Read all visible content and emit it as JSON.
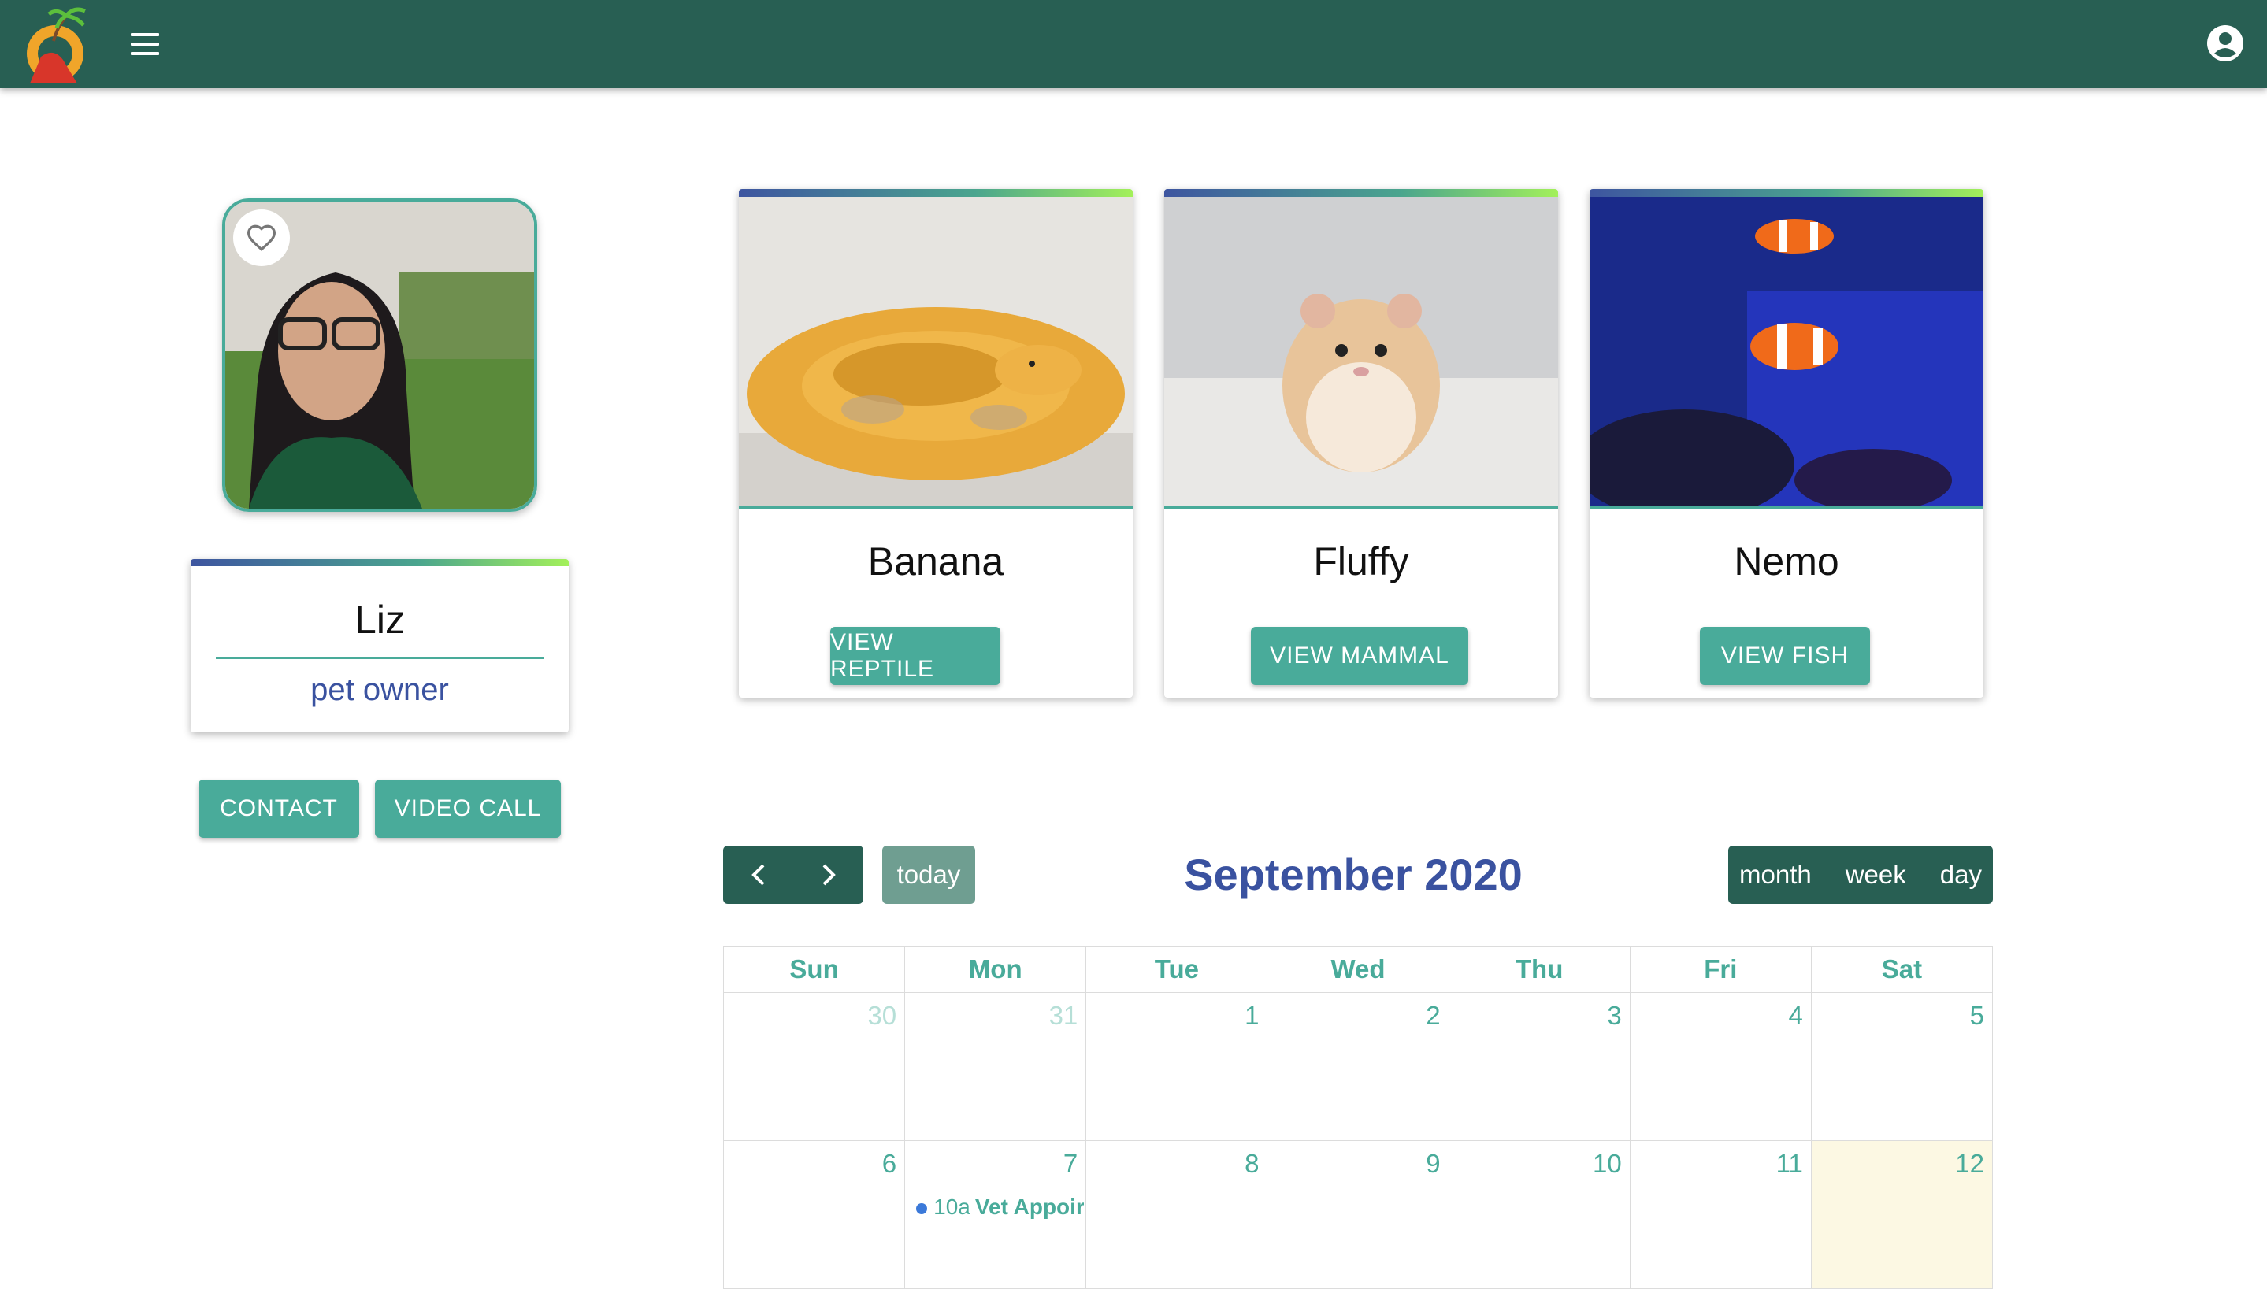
{
  "topbar": {
    "menu_icon": "hamburger-menu-icon",
    "account_icon": "account-circle-icon",
    "bg": "#285f53"
  },
  "profile": {
    "name": "Liz",
    "role": "pet owner",
    "contact_label": "CONTACT",
    "video_label": "VIDEO CALL"
  },
  "pets": [
    {
      "name": "Banana",
      "button": "VIEW REPTILE"
    },
    {
      "name": "Fluffy",
      "button": "VIEW MAMMAL"
    },
    {
      "name": "Nemo",
      "button": "VIEW FISH"
    }
  ],
  "calendar": {
    "title": "September 2020",
    "today_label": "today",
    "views": [
      "month",
      "week",
      "day"
    ],
    "weekdays": [
      "Sun",
      "Mon",
      "Tue",
      "Wed",
      "Thu",
      "Fri",
      "Sat"
    ],
    "weeks": [
      [
        "30",
        "31",
        "1",
        "2",
        "3",
        "4",
        "5"
      ],
      [
        "6",
        "7",
        "8",
        "9",
        "10",
        "11",
        "12"
      ]
    ],
    "event": {
      "time": "10a",
      "title": "Vet Appoir"
    }
  },
  "colors": {
    "accent": "#49ab9a",
    "title_blue": "#3a52a0",
    "dark_green": "#285f53"
  }
}
